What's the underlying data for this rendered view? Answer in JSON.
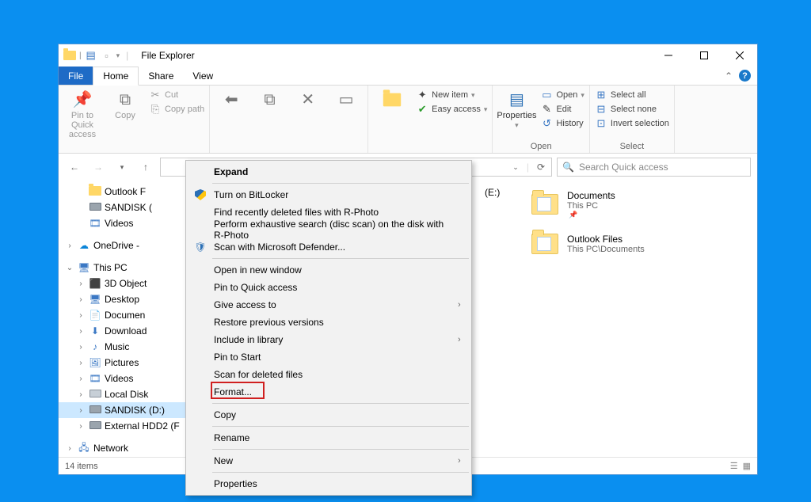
{
  "window": {
    "title": "File Explorer"
  },
  "tabs": {
    "file": "File",
    "home": "Home",
    "share": "Share",
    "view": "View"
  },
  "ribbon": {
    "pin": "Pin to Quick access",
    "copy": "Copy",
    "cut": "Cut",
    "copypath": "Copy path",
    "newitem": "New item",
    "easyaccess": "Easy access",
    "properties": "Properties",
    "open": "Open",
    "edit": "Edit",
    "history": "History",
    "open_group": "Open",
    "selectall": "Select all",
    "selectnone": "Select none",
    "invert": "Invert selection",
    "select_group": "Select"
  },
  "search": {
    "placeholder": "Search Quick access"
  },
  "tree": [
    {
      "indent": 1,
      "tw": "n",
      "emoji": "fo",
      "label": "Outlook F"
    },
    {
      "indent": 1,
      "tw": "n",
      "emoji": "dr",
      "label": "SANDISK ("
    },
    {
      "indent": 1,
      "tw": "n",
      "emoji": "vi",
      "label": "Videos"
    },
    {
      "type": "gap"
    },
    {
      "indent": 0,
      "tw": ">",
      "emoji": "od",
      "label": "OneDrive -"
    },
    {
      "type": "gap"
    },
    {
      "indent": 0,
      "tw": "v",
      "emoji": "pc",
      "label": "This PC"
    },
    {
      "indent": 1,
      "tw": ">",
      "emoji": "3d",
      "label": "3D Object"
    },
    {
      "indent": 1,
      "tw": ">",
      "emoji": "dk",
      "label": "Desktop"
    },
    {
      "indent": 1,
      "tw": ">",
      "emoji": "dc",
      "label": "Documen"
    },
    {
      "indent": 1,
      "tw": ">",
      "emoji": "dl",
      "label": "Download"
    },
    {
      "indent": 1,
      "tw": ">",
      "emoji": "mu",
      "label": "Music"
    },
    {
      "indent": 1,
      "tw": ">",
      "emoji": "pi",
      "label": "Pictures"
    },
    {
      "indent": 1,
      "tw": ">",
      "emoji": "vi",
      "label": "Videos"
    },
    {
      "indent": 1,
      "tw": ">",
      "emoji": "ld",
      "label": "Local Disk"
    },
    {
      "indent": 1,
      "tw": ">",
      "emoji": "dr",
      "label": "SANDISK (D:)",
      "sel": true
    },
    {
      "indent": 1,
      "tw": ">",
      "emoji": "dr",
      "label": "External HDD2 (F"
    },
    {
      "type": "gap"
    },
    {
      "indent": 0,
      "tw": ">",
      "emoji": "nw",
      "label": "Network"
    }
  ],
  "content": {
    "left_extra": "(E:)",
    "items": [
      {
        "name": "Documents",
        "sub": "This PC",
        "pin": true
      },
      {
        "name": "Outlook Files",
        "sub": "This PC\\Documents"
      }
    ]
  },
  "context": [
    {
      "type": "item",
      "bold": true,
      "icon": "",
      "label": "Expand"
    },
    {
      "type": "sep"
    },
    {
      "type": "item",
      "icon": "shield",
      "label": "Turn on BitLocker"
    },
    {
      "type": "item",
      "icon": "",
      "label": "Find recently deleted files with R-Photo"
    },
    {
      "type": "item",
      "icon": "",
      "label": "Perform exhaustive search (disc scan) on the disk with R-Photo"
    },
    {
      "type": "item",
      "icon": "def",
      "label": "Scan with Microsoft Defender..."
    },
    {
      "type": "sep"
    },
    {
      "type": "item",
      "icon": "",
      "label": "Open in new window"
    },
    {
      "type": "item",
      "icon": "",
      "label": "Pin to Quick access"
    },
    {
      "type": "item",
      "icon": "",
      "label": "Give access to",
      "sub": true
    },
    {
      "type": "item",
      "icon": "",
      "label": "Restore previous versions"
    },
    {
      "type": "item",
      "icon": "",
      "label": "Include in library",
      "sub": true
    },
    {
      "type": "item",
      "icon": "",
      "label": "Pin to Start"
    },
    {
      "type": "item",
      "icon": "",
      "label": "Scan for deleted files"
    },
    {
      "type": "item",
      "icon": "",
      "label": "Format...",
      "hl": true
    },
    {
      "type": "sep"
    },
    {
      "type": "item",
      "icon": "",
      "label": "Copy"
    },
    {
      "type": "sep"
    },
    {
      "type": "item",
      "icon": "",
      "label": "Rename"
    },
    {
      "type": "sep"
    },
    {
      "type": "item",
      "icon": "",
      "label": "New",
      "sub": true
    },
    {
      "type": "sep"
    },
    {
      "type": "item",
      "icon": "",
      "label": "Properties"
    }
  ],
  "status": {
    "count": "14 items"
  }
}
